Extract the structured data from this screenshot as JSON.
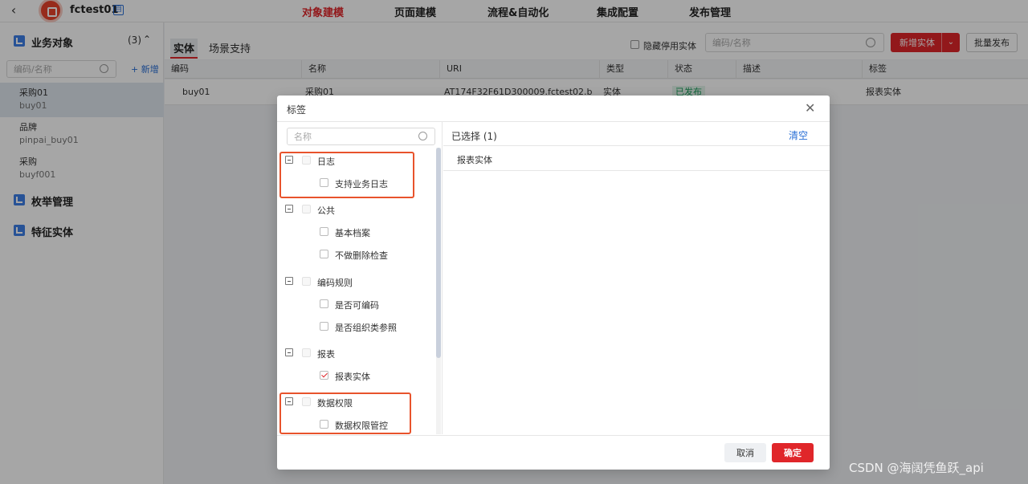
{
  "topbar": {
    "app_name": "fctest01",
    "app_tag": "自",
    "nav": [
      "对象建模",
      "页面建模",
      "流程&自动化",
      "集成配置",
      "发布管理"
    ]
  },
  "sidebar": {
    "group1_label": "业务对象",
    "group1_count": "(3)",
    "search_placeholder": "编码/名称",
    "add_label": "+ 新增",
    "items": [
      {
        "name": "采购01",
        "code": "buy01"
      },
      {
        "name": "品牌",
        "code": "pinpai_buy01"
      },
      {
        "name": "采购",
        "code": "buyf001"
      }
    ],
    "group2_label": "枚举管理",
    "group3_label": "特征实体"
  },
  "main": {
    "tabs": [
      "实体",
      "场景支持"
    ],
    "hide_disabled_label": "隐藏停用实体",
    "search_placeholder": "编码/名称",
    "new_button": "新增实体",
    "batch_button": "批量发布",
    "columns": [
      "编码",
      "名称",
      "URI",
      "类型",
      "状态",
      "描述",
      "标签"
    ],
    "row": {
      "code": "buy01",
      "name": "采购01",
      "uri": "AT174F32F61D300009.fctest02.b",
      "type": "实体",
      "status": "已发布",
      "desc": "",
      "tag": "报表实体"
    }
  },
  "modal": {
    "title": "标签",
    "search_placeholder": "名称",
    "groups": [
      {
        "label": "日志",
        "children": [
          {
            "label": "支持业务日志",
            "checked": false
          }
        ]
      },
      {
        "label": "公共",
        "children": [
          {
            "label": "基本档案",
            "checked": false
          },
          {
            "label": "不做删除检查",
            "checked": false
          }
        ]
      },
      {
        "label": "编码规则",
        "children": [
          {
            "label": "是否可编码",
            "checked": false
          },
          {
            "label": "是否组织类参照",
            "checked": false
          }
        ]
      },
      {
        "label": "报表",
        "children": [
          {
            "label": "报表实体",
            "checked": true
          }
        ]
      },
      {
        "label": "数据权限",
        "children": [
          {
            "label": "数据权限管控",
            "checked": false
          }
        ]
      }
    ],
    "selected_title": "已选择 (1)",
    "clear_label": "清空",
    "selected_items": [
      "报表实体"
    ],
    "cancel_label": "取消",
    "ok_label": "确定"
  },
  "watermark": "CSDN @海阔凭鱼跃_api",
  "colors": {
    "accent": "#e0262a",
    "link": "#2a6fd6",
    "highlight": "#e8532c"
  }
}
